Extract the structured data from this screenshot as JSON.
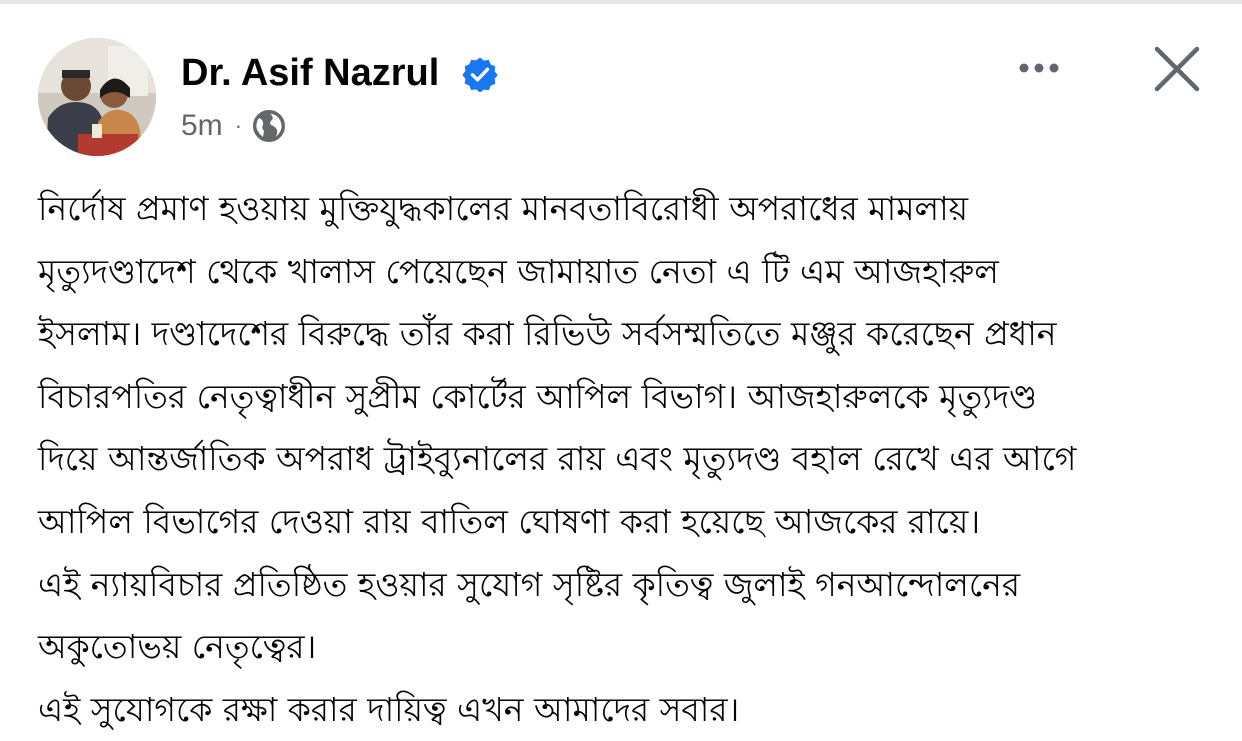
{
  "post": {
    "author": {
      "name": "Dr. Asif Nazrul",
      "verified_icon": "verified-badge-icon",
      "avatar_icon": "profile-photo"
    },
    "meta": {
      "time": "5m",
      "separator": "·",
      "audience_icon": "globe-icon"
    },
    "actions": {
      "more_icon": "more-horizontal-icon",
      "close_icon": "close-icon"
    },
    "body_lines": [
      "নির্দোষ প্রমাণ হওয়ায় মুক্তিযুদ্ধকালের মানবতাবিরোধী অপরাধের মামলায়",
      "মৃত্যুদণ্ডাদেশ থেকে খালাস পেয়েছেন জামায়াত নেতা এ টি এম আজহারুল",
      "ইসলাম। দণ্ডাদেশের বিরুদ্ধে তাঁর করা রিভিউ সর্বসম্মতিতে মঞ্জুর করেছেন প্রধান",
      "বিচারপতির নেতৃত্বাধীন সুপ্রীম কোর্টের আপিল বিভাগ। আজহারুলকে মৃত্যুদণ্ড",
      "দিয়ে আন্তর্জাতিক অপরাধ ট্রাইব্যুনালের রায় এবং মৃত্যুদণ্ড বহাল রেখে এর আগে",
      "আপিল বিভাগের দেওয়া রায় বাতিল ঘোষণা করা হয়েছে আজকের রায়ে।",
      "এই ন্যায়বিচার প্রতিষ্ঠিত হওয়ার সুযোগ সৃষ্টির কৃতিত্ব জুলাই গনআন্দোলনের",
      "অকুতোভয় নেতৃত্বের।",
      "এই সুযোগকে রক্ষা করার দায়িত্ব এখন আমাদের সবার।"
    ]
  },
  "colors": {
    "verified_blue": "#1877f2",
    "secondary_text": "#65676b",
    "primary_text": "#050505",
    "icon_gray": "#606770"
  }
}
